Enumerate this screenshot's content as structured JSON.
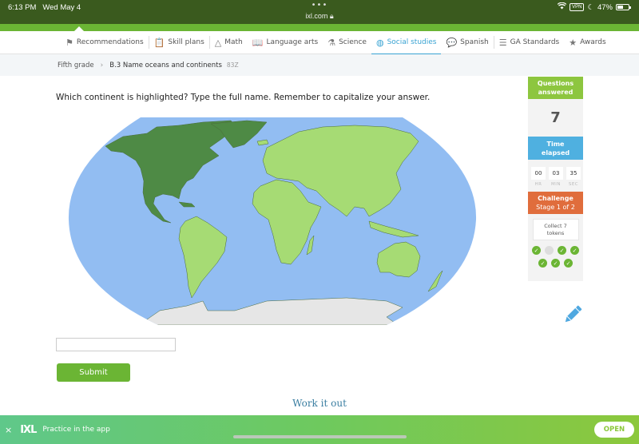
{
  "status_bar": {
    "time": "6:13 PM",
    "date": "Wed May 4",
    "url": "ixl.com",
    "vpn_label": "VPN",
    "battery": "47%"
  },
  "nav": {
    "items": [
      {
        "label": "Recommendations",
        "icon": "signpost-icon",
        "glyph": "⚑",
        "active": false
      },
      {
        "label": "Skill plans",
        "icon": "clipboard-icon",
        "glyph": "📋",
        "active": false
      },
      {
        "label": "Math",
        "icon": "pyramid-icon",
        "glyph": "△",
        "active": false
      },
      {
        "label": "Language arts",
        "icon": "book-icon",
        "glyph": "📖",
        "active": false
      },
      {
        "label": "Science",
        "icon": "flask-icon",
        "glyph": "⚗",
        "active": false
      },
      {
        "label": "Social studies",
        "icon": "globe-icon",
        "glyph": "◍",
        "active": true
      },
      {
        "label": "Spanish",
        "icon": "speech-bubble-icon",
        "glyph": "💬",
        "active": false
      },
      {
        "label": "GA Standards",
        "icon": "list-icon",
        "glyph": "☰",
        "active": false
      },
      {
        "label": "Awards",
        "icon": "trophy-icon",
        "glyph": "★",
        "active": false
      }
    ]
  },
  "breadcrumb": {
    "grade": "Fifth grade",
    "skill": "B.3 Name oceans and continents",
    "code": "83Z"
  },
  "question": {
    "prompt": "Which continent is highlighted? Type the full name. Remember to capitalize your answer.",
    "highlighted_continent_color": "#4e8a45",
    "land_color": "#a6db74",
    "ocean_color": "#92bdf2",
    "antarctica_color": "#e6e6e6"
  },
  "answer": {
    "value": "",
    "placeholder": ""
  },
  "submit_label": "Submit",
  "work_it_out": "Work it out",
  "sidebar": {
    "questions_answered_label_1": "Questions",
    "questions_answered_label_2": "answered",
    "questions_answered": "7",
    "time_elapsed_label_1": "Time",
    "time_elapsed_label_2": "elapsed",
    "timer": [
      {
        "value": "00",
        "unit": "HR"
      },
      {
        "value": "03",
        "unit": "MIN"
      },
      {
        "value": "35",
        "unit": "SEC"
      }
    ],
    "challenge_label": "Challenge",
    "challenge_stage": "Stage 1 of 2",
    "collect_1": "Collect 7",
    "collect_2": "tokens",
    "tokens": [
      true,
      false,
      true,
      true,
      true,
      true,
      true
    ]
  },
  "banner": {
    "close": "×",
    "logo": "IXL",
    "text": "Practice in the app",
    "open_label": "OPEN"
  }
}
